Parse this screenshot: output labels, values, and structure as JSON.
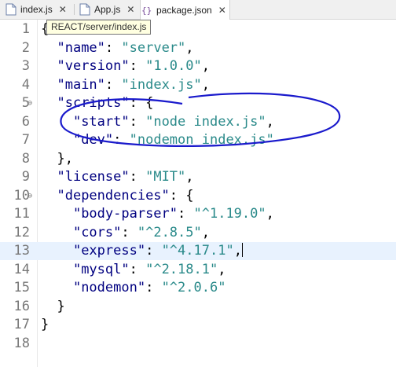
{
  "tabs": [
    {
      "label": "index.js",
      "icon": "js-file-icon",
      "close": "✕"
    },
    {
      "label": "App.js",
      "icon": "js-file-icon",
      "close": "✕"
    },
    {
      "label": "package.json",
      "icon": "json-file-icon",
      "close": "✕"
    }
  ],
  "tooltip": "REACT/server/index.js",
  "lines": [
    {
      "n": "1",
      "fold": "",
      "parts": [
        {
          "t": "{",
          "c": "p"
        }
      ]
    },
    {
      "n": "2",
      "fold": "",
      "parts": [
        {
          "t": "  ",
          "c": "p"
        },
        {
          "t": "\"name\"",
          "c": "k"
        },
        {
          "t": ": ",
          "c": "p"
        },
        {
          "t": "\"server\"",
          "c": "s"
        },
        {
          "t": ",",
          "c": "p"
        }
      ]
    },
    {
      "n": "3",
      "fold": "",
      "parts": [
        {
          "t": "  ",
          "c": "p"
        },
        {
          "t": "\"version\"",
          "c": "k"
        },
        {
          "t": ": ",
          "c": "p"
        },
        {
          "t": "\"1.0.0\"",
          "c": "s"
        },
        {
          "t": ",",
          "c": "p"
        }
      ]
    },
    {
      "n": "4",
      "fold": "",
      "parts": [
        {
          "t": "  ",
          "c": "p"
        },
        {
          "t": "\"main\"",
          "c": "k"
        },
        {
          "t": ": ",
          "c": "p"
        },
        {
          "t": "\"index.js\"",
          "c": "s"
        },
        {
          "t": ",",
          "c": "p"
        }
      ]
    },
    {
      "n": "5",
      "fold": "⊖",
      "parts": [
        {
          "t": "  ",
          "c": "p"
        },
        {
          "t": "\"scripts\"",
          "c": "k"
        },
        {
          "t": ": {",
          "c": "p"
        }
      ]
    },
    {
      "n": "6",
      "fold": "",
      "parts": [
        {
          "t": "    ",
          "c": "p"
        },
        {
          "t": "\"start\"",
          "c": "k"
        },
        {
          "t": ": ",
          "c": "p"
        },
        {
          "t": "\"node index.js\"",
          "c": "s"
        },
        {
          "t": ",",
          "c": "p"
        }
      ]
    },
    {
      "n": "7",
      "fold": "",
      "parts": [
        {
          "t": "    ",
          "c": "p"
        },
        {
          "t": "\"dev\"",
          "c": "k"
        },
        {
          "t": ": ",
          "c": "p"
        },
        {
          "t": "\"nodemon index.js\"",
          "c": "s"
        }
      ]
    },
    {
      "n": "8",
      "fold": "",
      "parts": [
        {
          "t": "  },",
          "c": "p"
        }
      ]
    },
    {
      "n": "9",
      "fold": "",
      "parts": [
        {
          "t": "  ",
          "c": "p"
        },
        {
          "t": "\"license\"",
          "c": "k"
        },
        {
          "t": ": ",
          "c": "p"
        },
        {
          "t": "\"MIT\"",
          "c": "s"
        },
        {
          "t": ",",
          "c": "p"
        }
      ]
    },
    {
      "n": "10",
      "fold": "⊖",
      "parts": [
        {
          "t": "  ",
          "c": "p"
        },
        {
          "t": "\"dependencies\"",
          "c": "k"
        },
        {
          "t": ": {",
          "c": "p"
        }
      ]
    },
    {
      "n": "11",
      "fold": "",
      "parts": [
        {
          "t": "    ",
          "c": "p"
        },
        {
          "t": "\"body-parser\"",
          "c": "k"
        },
        {
          "t": ": ",
          "c": "p"
        },
        {
          "t": "\"^1.19.0\"",
          "c": "s"
        },
        {
          "t": ",",
          "c": "p"
        }
      ]
    },
    {
      "n": "12",
      "fold": "",
      "parts": [
        {
          "t": "    ",
          "c": "p"
        },
        {
          "t": "\"cors\"",
          "c": "k"
        },
        {
          "t": ": ",
          "c": "p"
        },
        {
          "t": "\"^2.8.5\"",
          "c": "s"
        },
        {
          "t": ",",
          "c": "p"
        }
      ]
    },
    {
      "n": "13",
      "fold": "",
      "current": true,
      "parts": [
        {
          "t": "    ",
          "c": "p"
        },
        {
          "t": "\"express\"",
          "c": "k"
        },
        {
          "t": ": ",
          "c": "p"
        },
        {
          "t": "\"^4.17.1\"",
          "c": "s"
        },
        {
          "t": ",",
          "c": "p"
        }
      ]
    },
    {
      "n": "14",
      "fold": "",
      "parts": [
        {
          "t": "    ",
          "c": "p"
        },
        {
          "t": "\"mysql\"",
          "c": "k"
        },
        {
          "t": ": ",
          "c": "p"
        },
        {
          "t": "\"^2.18.1\"",
          "c": "s"
        },
        {
          "t": ",",
          "c": "p"
        }
      ]
    },
    {
      "n": "15",
      "fold": "",
      "parts": [
        {
          "t": "    ",
          "c": "p"
        },
        {
          "t": "\"nodemon\"",
          "c": "k"
        },
        {
          "t": ": ",
          "c": "p"
        },
        {
          "t": "\"^2.0.6\"",
          "c": "s"
        }
      ]
    },
    {
      "n": "16",
      "fold": "",
      "parts": [
        {
          "t": "  }",
          "c": "p"
        }
      ]
    },
    {
      "n": "17",
      "fold": "",
      "parts": [
        {
          "t": "}",
          "c": "p"
        }
      ]
    },
    {
      "n": "18",
      "fold": "",
      "parts": []
    }
  ],
  "colors": {
    "key": "#000080",
    "string": "#2a8a8a",
    "annotation": "#1a1acc",
    "current_line": "#e8f2fe"
  }
}
